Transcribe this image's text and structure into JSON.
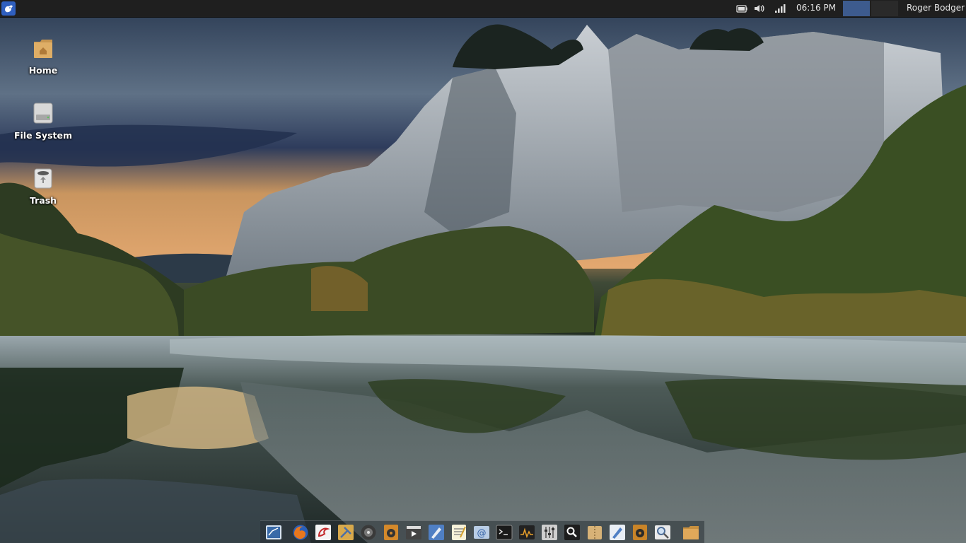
{
  "top_panel": {
    "clock": "06:16 PM",
    "user": "Roger Bodger",
    "tray_icons": [
      "battery-icon",
      "volume-icon",
      "network-signal-icon"
    ]
  },
  "desktop_icons": [
    {
      "name": "home-folder-icon",
      "label": "Home"
    },
    {
      "name": "file-system-icon",
      "label": "File System"
    },
    {
      "name": "trash-icon",
      "label": "Trash"
    }
  ],
  "dock": {
    "items": [
      "desktop-icon",
      "firefox-icon",
      "text-editor-icon",
      "tools-icon",
      "disc-burner-icon",
      "audio-player-icon",
      "video-player-icon",
      "drawing-icon",
      "notes-icon",
      "mail-icon",
      "terminal-icon",
      "system-monitor-icon",
      "mixer-icon",
      "search-icon",
      "archive-manager-icon",
      "inkscape-icon",
      "speaker-icon",
      "magnifier-icon",
      "files-icon"
    ]
  },
  "colors": {
    "panel_bg": "#1f1f1f",
    "panel_text": "#e6e6e6",
    "workspace_active": "#3d5b8e",
    "menu_button": "#2f5fbf"
  }
}
